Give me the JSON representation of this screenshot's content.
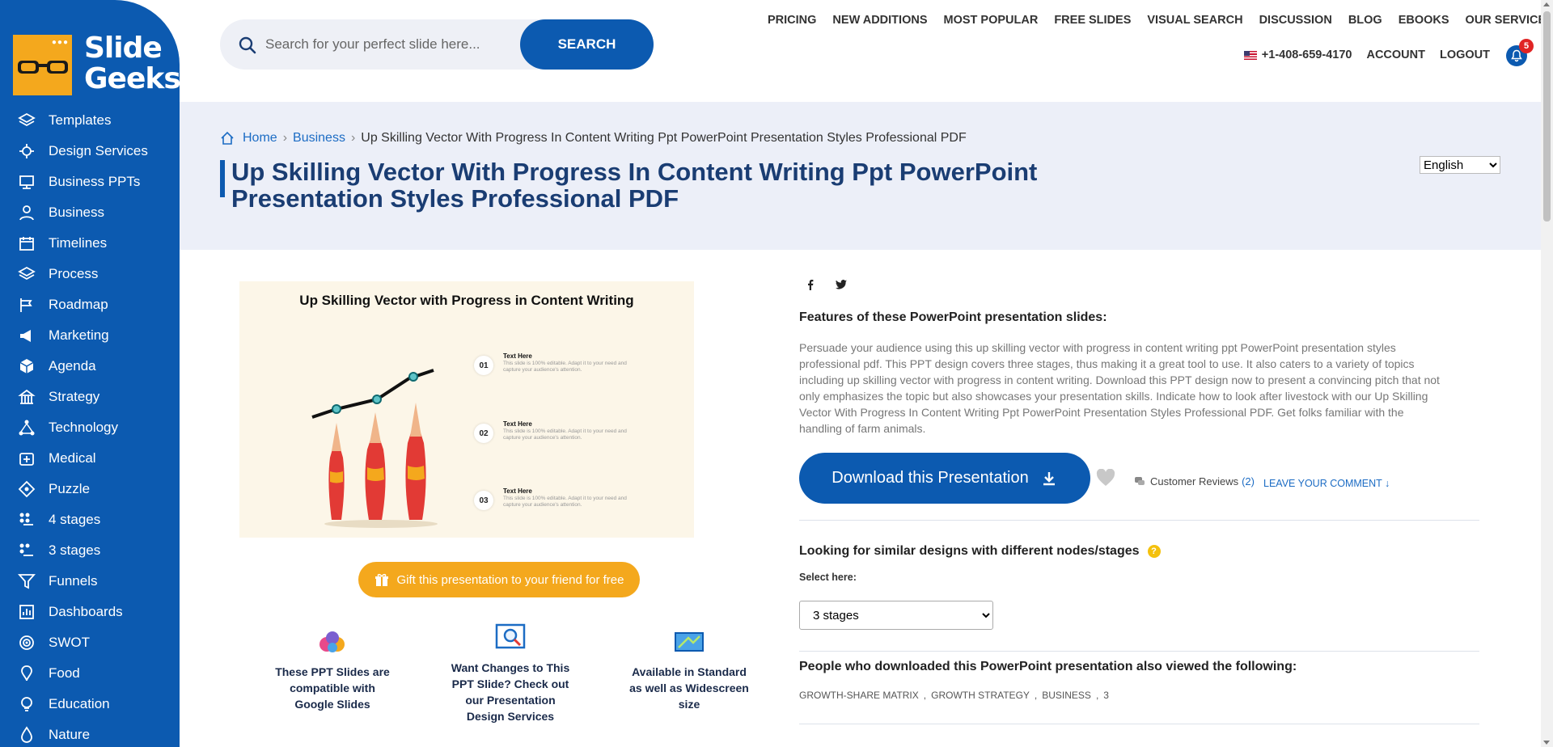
{
  "brand": {
    "name_line1": "Slide",
    "name_line2": "Geeks"
  },
  "sidebar": {
    "items": [
      {
        "label": "Templates",
        "icon": "layers-icon"
      },
      {
        "label": "Design Services",
        "icon": "design-icon"
      },
      {
        "label": "Business PPTs",
        "icon": "business-ppt-icon"
      },
      {
        "label": "Business",
        "icon": "business-icon"
      },
      {
        "label": "Timelines",
        "icon": "calendar-icon"
      },
      {
        "label": "Process",
        "icon": "layers-icon"
      },
      {
        "label": "Roadmap",
        "icon": "roadmap-icon"
      },
      {
        "label": "Marketing",
        "icon": "megaphone-icon"
      },
      {
        "label": "Agenda",
        "icon": "cube-icon"
      },
      {
        "label": "Strategy",
        "icon": "strategy-icon"
      },
      {
        "label": "Technology",
        "icon": "network-icon"
      },
      {
        "label": "Medical",
        "icon": "medical-icon"
      },
      {
        "label": "Puzzle",
        "icon": "puzzle-icon"
      },
      {
        "label": "4 stages",
        "icon": "stages-icon"
      },
      {
        "label": "3 stages",
        "icon": "stages-icon"
      },
      {
        "label": "Funnels",
        "icon": "funnel-icon"
      },
      {
        "label": "Dashboards",
        "icon": "dashboard-icon"
      },
      {
        "label": "SWOT",
        "icon": "target-icon"
      },
      {
        "label": "Food",
        "icon": "food-icon"
      },
      {
        "label": "Education",
        "icon": "bulb-icon"
      },
      {
        "label": "Nature",
        "icon": "drop-icon"
      }
    ]
  },
  "search": {
    "placeholder": "Search for your perfect slide here...",
    "value": "",
    "button": "SEARCH"
  },
  "topnav": {
    "pricing": "PRICING",
    "new_additions": "NEW ADDITIONS",
    "most_popular": "MOST POPULAR",
    "free_slides": "FREE SLIDES",
    "visual_search": "VISUAL SEARCH",
    "discussion": "DISCUSSION",
    "blog": "BLOG",
    "ebooks": "EBOOKS",
    "our_services": "OUR SERVICES",
    "phone": "+1-408-659-4170",
    "account": "ACCOUNT",
    "logout": "LOGOUT",
    "notification_count": "5"
  },
  "breadcrumb": {
    "home": "Home",
    "category": "Business",
    "current": "Up Skilling Vector With Progress In Content Writing Ppt PowerPoint Presentation Styles Professional PDF"
  },
  "page": {
    "title": "Up Skilling Vector With Progress In Content Writing Ppt PowerPoint Presentation Styles Professional PDF",
    "language": "English"
  },
  "preview": {
    "title": "Up Skilling Vector with Progress in Content Writing",
    "items": [
      {
        "num": "01",
        "head": "Text Here",
        "body": "This slide is 100% editable. Adapt it to your need and capture your audience's attention."
      },
      {
        "num": "02",
        "head": "Text Here",
        "body": "This slide is 100% editable. Adapt it to your need and capture your audience's attention."
      },
      {
        "num": "03",
        "head": "Text Here",
        "body": "This slide is 100% editable. Adapt it to your need and capture your audience's attention."
      }
    ]
  },
  "gift_button": "Gift this presentation to your friend for free",
  "features_badges": [
    {
      "text": "These PPT Slides are compatible with Google Slides",
      "icon": "google-slides-icon"
    },
    {
      "text": "Want Changes to This PPT Slide? Check out our Presentation Design Services",
      "icon": "design-search-icon"
    },
    {
      "text": "Available in Standard as well as Widescreen size",
      "icon": "widescreen-icon"
    }
  ],
  "details": {
    "features_heading": "Features of these PowerPoint presentation slides:",
    "description": "Persuade your audience using this up skilling vector with progress in content writing ppt PowerPoint presentation styles professional pdf. This PPT design covers three stages, thus making it a great tool to use. It also caters to a variety of topics including up skilling vector with progress in content writing. Download this PPT design now to present a convincing pitch that not only emphasizes the topic but also showcases your presentation skills. Indicate how to look after livestock with our Up Skilling Vector With Progress In Content Writing Ppt PowerPoint Presentation Styles Professional PDF. Get folks familiar with the handling of farm animals.",
    "download_button": "Download this Presentation",
    "reviews_label": "Customer Reviews",
    "reviews_count": "(2)",
    "leave_comment": "LEAVE YOUR COMMENT",
    "similar_heading": "Looking for similar designs with different nodes/stages",
    "select_label": "Select here:",
    "stages_selected": "3 stages",
    "also_viewed_heading": "People who downloaded this PowerPoint presentation also viewed the following:",
    "tags": [
      "GROWTH-SHARE MATRIX",
      ",",
      "GROWTH STRATEGY",
      ",",
      "BUSINESS",
      ",",
      "3"
    ]
  },
  "colors": {
    "primary": "#0c5ab0",
    "accent": "#f4a81d",
    "title": "#1a3d73",
    "band": "#eceff8"
  }
}
